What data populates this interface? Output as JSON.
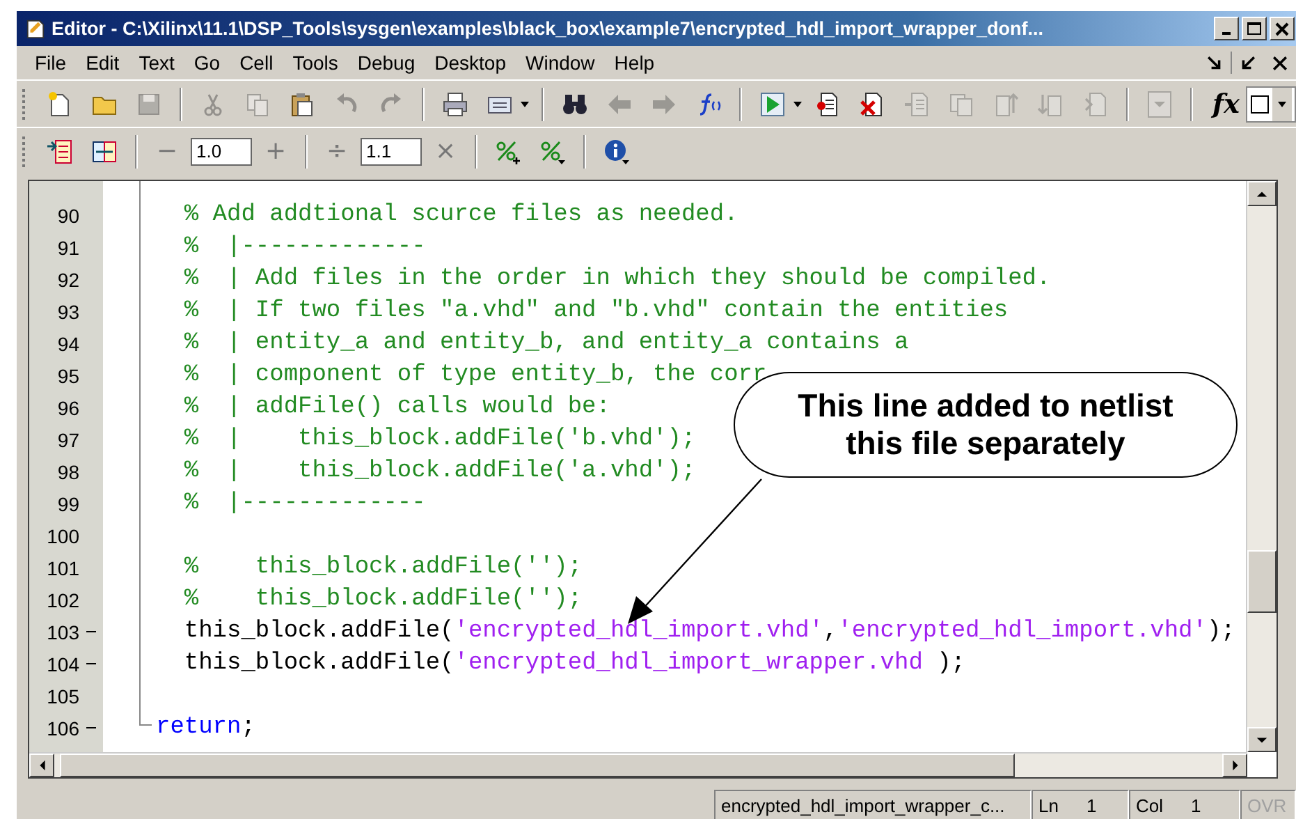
{
  "window": {
    "title": "Editor - C:\\Xilinx\\11.1\\DSP_Tools\\sysgen\\examples\\black_box\\example7\\encrypted_hdl_import_wrapper_donf..."
  },
  "menu": [
    "File",
    "Edit",
    "Text",
    "Go",
    "Cell",
    "Tools",
    "Debug",
    "Desktop",
    "Window",
    "Help"
  ],
  "toolbar_1": [
    {
      "disabled": false
    },
    {
      "disabled": false
    },
    {
      "disabled": true
    },
    {
      "disabled": true
    },
    {
      "disabled": true
    },
    {
      "disabled": false
    },
    {
      "disabled": true
    },
    {
      "disabled": true
    },
    {
      "disabled": false
    },
    {
      "disabled": false
    },
    {
      "disabled": false
    },
    {
      "disabled": true
    },
    {
      "disabled": true
    },
    {
      "disabled": false
    },
    {
      "disabled": false
    },
    {
      "disabled": false
    },
    {
      "disabled": false
    },
    {
      "disabled": true
    },
    {
      "disabled": true
    },
    {
      "disabled": true
    },
    {
      "disabled": true
    },
    {
      "disabled": true
    },
    {
      "disabled": true
    }
  ],
  "function_label": "fx",
  "toolbar_2": {
    "decrement": "−",
    "field_1": "1.0",
    "increment": "+",
    "divide": "÷",
    "field_2": "1.1",
    "multiply": "×"
  },
  "editor": {
    "lines": [
      {
        "number": "90",
        "executable": false,
        "segments": [
          {
            "kind": "comment",
            "text": "  % Add addtional scurce files as needed."
          }
        ]
      },
      {
        "number": "91",
        "executable": false,
        "segments": [
          {
            "kind": "comment",
            "text": "  %  |-------------"
          }
        ]
      },
      {
        "number": "92",
        "executable": false,
        "segments": [
          {
            "kind": "comment",
            "text": "  %  | Add files in the order in which they should be compiled."
          }
        ]
      },
      {
        "number": "93",
        "executable": false,
        "segments": [
          {
            "kind": "comment",
            "text": "  %  | If two files \"a.vhd\" and \"b.vhd\" contain the entities"
          }
        ]
      },
      {
        "number": "94",
        "executable": false,
        "segments": [
          {
            "kind": "comment",
            "text": "  %  | entity_a and entity_b, and entity_a contains a"
          }
        ]
      },
      {
        "number": "95",
        "executable": false,
        "segments": [
          {
            "kind": "comment",
            "text": "  %  | component of type entity_b, the corr"
          }
        ]
      },
      {
        "number": "96",
        "executable": false,
        "segments": [
          {
            "kind": "comment",
            "text": "  %  | addFile() calls would be:"
          }
        ]
      },
      {
        "number": "97",
        "executable": false,
        "segments": [
          {
            "kind": "comment",
            "text": "  %  |    this_block.addFile('b.vhd');"
          }
        ]
      },
      {
        "number": "98",
        "executable": false,
        "segments": [
          {
            "kind": "comment",
            "text": "  %  |    this_block.addFile('a.vhd');"
          }
        ]
      },
      {
        "number": "99",
        "executable": false,
        "segments": [
          {
            "kind": "comment",
            "text": "  %  |-------------"
          }
        ]
      },
      {
        "number": "100",
        "executable": false
      },
      {
        "number": "101",
        "executable": false,
        "segments": [
          {
            "kind": "comment",
            "text": "  %    this_block.addFile('');"
          }
        ]
      },
      {
        "number": "102",
        "executable": false,
        "segments": [
          {
            "kind": "comment",
            "text": "  %    this_block.addFile('');"
          }
        ]
      },
      {
        "number": "103",
        "executable": true,
        "segments": [
          {
            "kind": "code",
            "text": "  this_block.addFile("
          },
          {
            "kind": "string",
            "text": "'encrypted_hdl_import.vhd'"
          },
          {
            "kind": "code",
            "text": ","
          },
          {
            "kind": "string",
            "text": "'encrypted_hdl_import.vhd'"
          },
          {
            "kind": "code",
            "text": ");"
          }
        ]
      },
      {
        "number": "104",
        "executable": true,
        "segments": [
          {
            "kind": "code",
            "text": "  this_block.addFile("
          },
          {
            "kind": "string",
            "text": "'encrypted_hdl_import_wrapper.vhd"
          },
          {
            "kind": "code",
            "text": " );"
          }
        ]
      },
      {
        "number": "105",
        "executable": false
      },
      {
        "number": "106",
        "executable": true,
        "segments": [
          {
            "kind": "keyword",
            "text": "return"
          },
          {
            "kind": "code",
            "text": ";"
          }
        ]
      }
    ]
  },
  "callout": {
    "lines": [
      "This line added to netlist",
      "this file separately"
    ]
  },
  "status_bar": {
    "file": "encrypted_hdl_import_wrapper_c...",
    "ln_label": "Ln",
    "ln": "1",
    "col_label": "Col",
    "col": "1",
    "ovr": "OVR",
    "ovr_active": false
  }
}
